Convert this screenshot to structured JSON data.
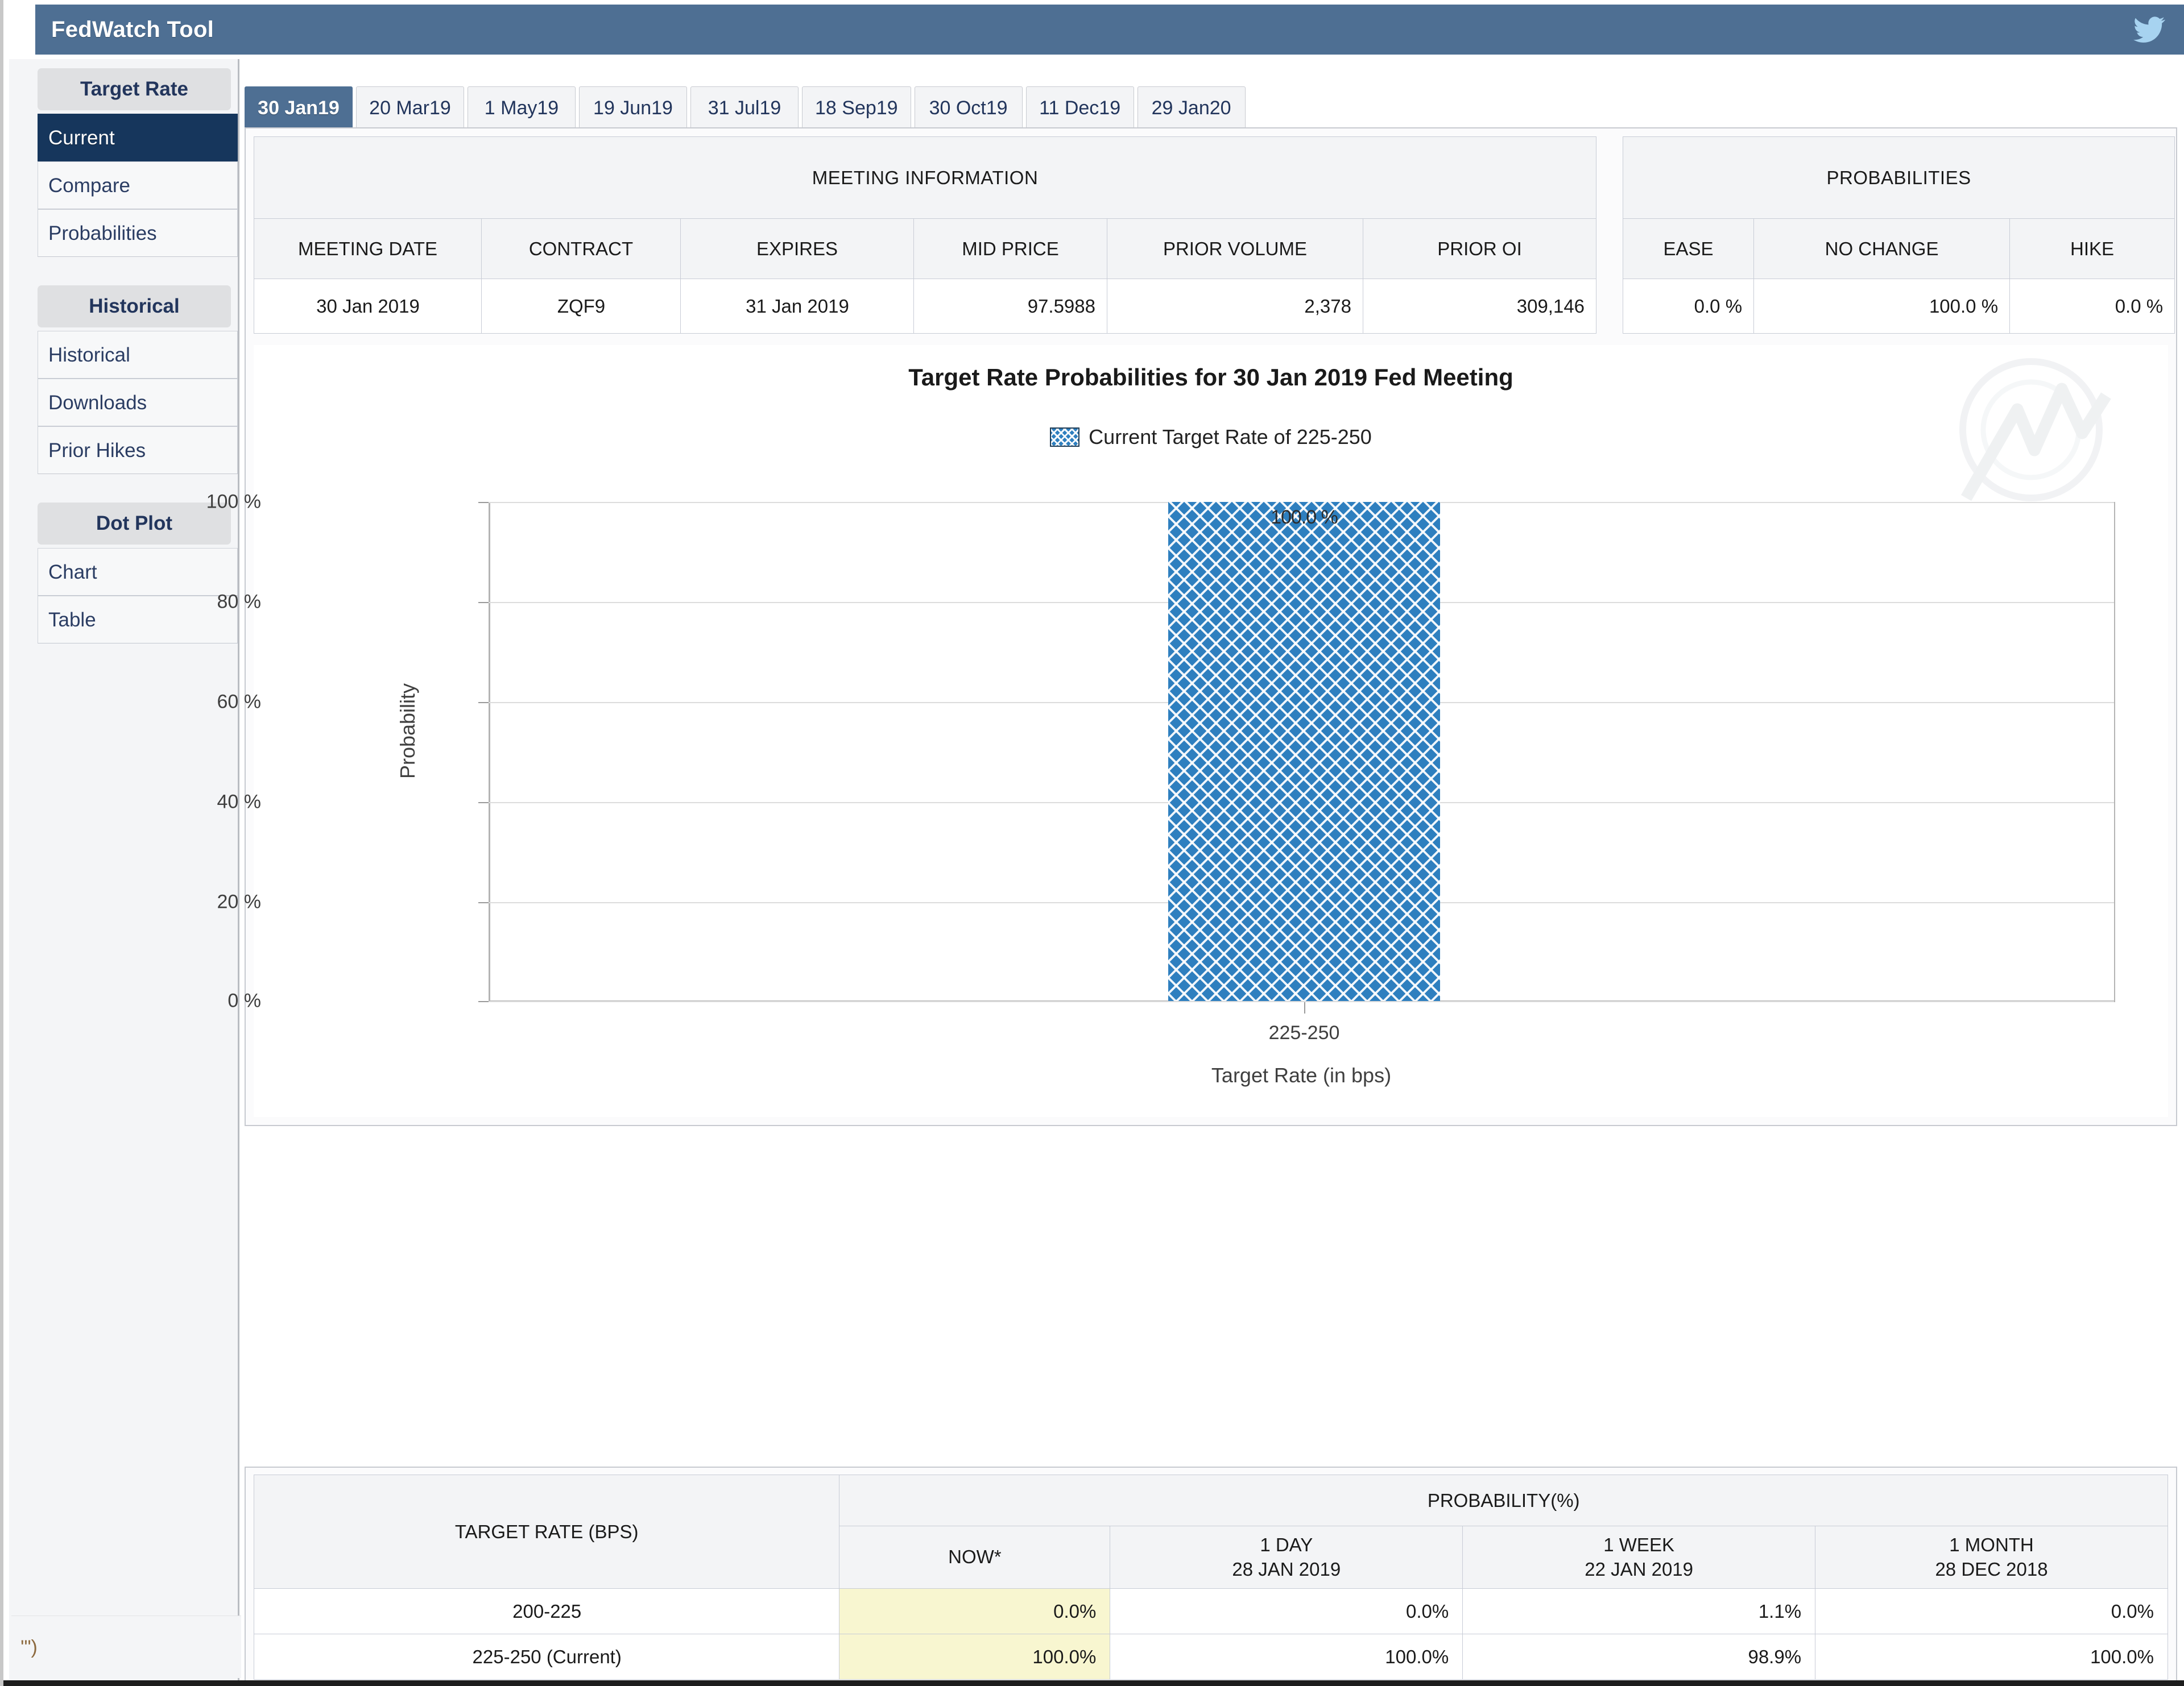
{
  "app": {
    "title": "FedWatch Tool",
    "twitter_icon": "twitter-bird-icon",
    "header_color": "#4e6f93"
  },
  "sidebar": {
    "groups": [
      {
        "heading": "Target Rate",
        "items": [
          {
            "label": "Current",
            "active": true
          },
          {
            "label": "Compare",
            "active": false
          },
          {
            "label": "Probabilities",
            "active": false
          }
        ]
      },
      {
        "heading": "Historical",
        "items": [
          {
            "label": "Historical",
            "active": false
          },
          {
            "label": "Downloads",
            "active": false
          },
          {
            "label": "Prior Hikes",
            "active": false
          }
        ]
      },
      {
        "heading": "Dot Plot",
        "items": [
          {
            "label": "Chart",
            "active": false
          },
          {
            "label": "Table",
            "active": false
          }
        ]
      }
    ],
    "corner_scrap": "'\")"
  },
  "tabs": [
    {
      "label": "30 Jan19",
      "active": true
    },
    {
      "label": "20 Mar19",
      "active": false
    },
    {
      "label": "1 May19",
      "active": false
    },
    {
      "label": "19 Jun19",
      "active": false
    },
    {
      "label": "31 Jul19",
      "active": false
    },
    {
      "label": "18 Sep19",
      "active": false
    },
    {
      "label": "30 Oct19",
      "active": false
    },
    {
      "label": "11 Dec19",
      "active": false
    },
    {
      "label": "29 Jan20",
      "active": false
    }
  ],
  "meeting_information": {
    "section_title": "MEETING INFORMATION",
    "columns": [
      "MEETING DATE",
      "CONTRACT",
      "EXPIRES",
      "MID PRICE",
      "PRIOR VOLUME",
      "PRIOR OI"
    ],
    "row": [
      "30 Jan 2019",
      "ZQF9",
      "31 Jan 2019",
      "97.5988",
      "2,378",
      "309,146"
    ]
  },
  "probabilities_summary": {
    "section_title": "PROBABILITIES",
    "columns": [
      "EASE",
      "NO CHANGE",
      "HIKE"
    ],
    "row": [
      "0.0 %",
      "100.0 %",
      "0.0 %"
    ]
  },
  "chart_data": {
    "type": "bar",
    "title": "Target Rate Probabilities for 30 Jan 2019 Fed Meeting",
    "legend": [
      {
        "label": "Current Target Rate of 225-250",
        "color": "#2e7fbf",
        "pattern": "crosshatch"
      }
    ],
    "legend_position": "top-center",
    "categories": [
      "225-250"
    ],
    "values": [
      100.0
    ],
    "value_labels": [
      "100.0 %"
    ],
    "xlabel": "Target Rate (in bps)",
    "ylabel": "Probability",
    "ylim": [
      0,
      100
    ],
    "yticks": [
      0,
      20,
      40,
      60,
      80,
      100
    ],
    "ytick_labels": [
      "0 %",
      "20 %",
      "40 %",
      "60 %",
      "80 %",
      "100 %"
    ],
    "grid": true,
    "watermark": "cme-group-logo-watermark"
  },
  "detail_table": {
    "rate_header": "TARGET RATE (BPS)",
    "prob_header": "PROBABILITY(%)",
    "sub_headers": [
      {
        "line1": "NOW",
        "line2": "*",
        "highlight": true
      },
      {
        "line1": "1 DAY",
        "line2": "28 JAN 2019",
        "highlight": false
      },
      {
        "line1": "1 WEEK",
        "line2": "22 JAN 2019",
        "highlight": false
      },
      {
        "line1": "1 MONTH",
        "line2": "28 DEC 2018",
        "highlight": false
      }
    ],
    "rows": [
      {
        "rate": "200-225",
        "now": "0.0%",
        "day": "0.0%",
        "week": "1.1%",
        "month": "0.0%"
      },
      {
        "rate": "225-250 (Current)",
        "now": "100.0%",
        "day": "100.0%",
        "week": "98.9%",
        "month": "100.0%"
      }
    ]
  }
}
